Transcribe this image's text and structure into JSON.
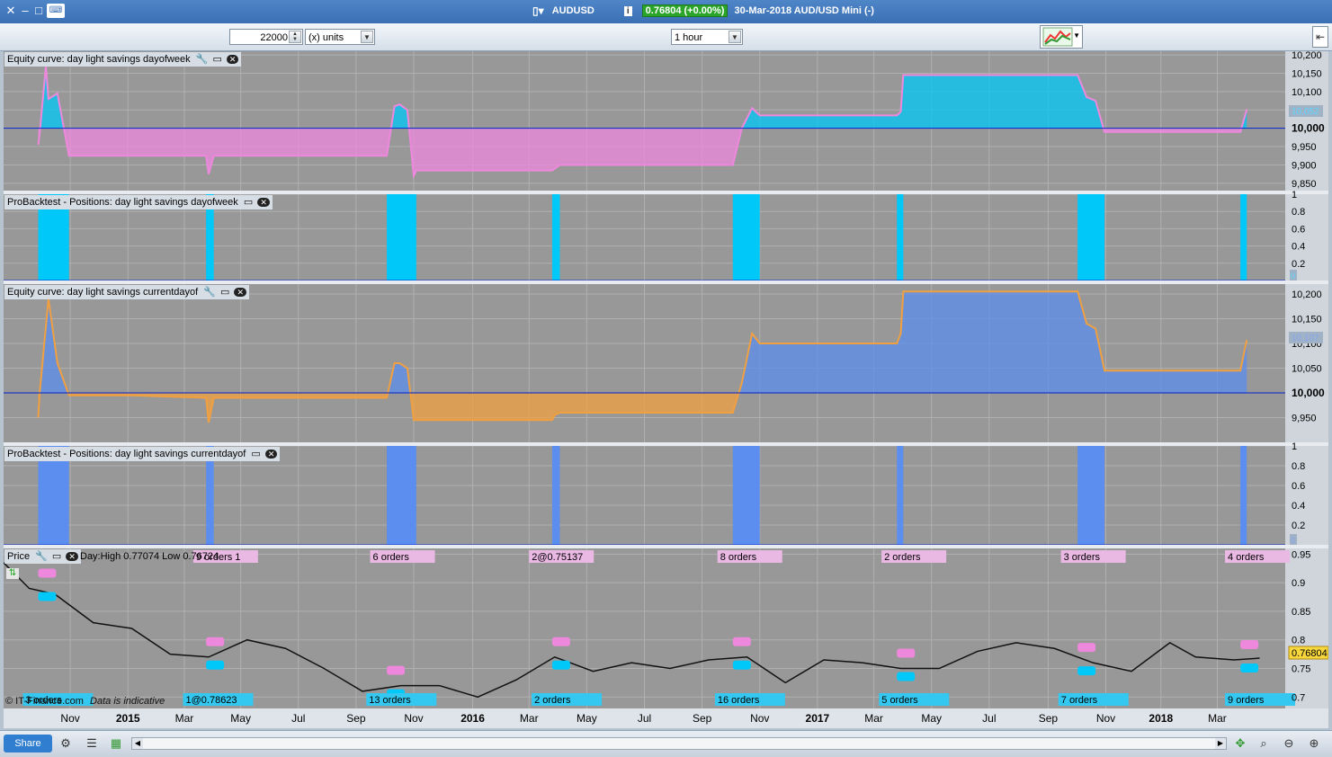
{
  "window": {
    "instrument": "AUDUSD",
    "price": "0.76804 (+0.00%)",
    "date_info": "30-Mar-2018 AUD/USD Mini (-)"
  },
  "toolbar": {
    "quantity": "22000",
    "units": "(x) units",
    "timeframe": "1 hour"
  },
  "colors": {
    "panel_bg": "#989898",
    "cyan": "#00c8f8",
    "pink": "#ee88dd",
    "blue_fill": "#5b8eee",
    "orange": "#f0a040",
    "baseline": "#0022cc"
  },
  "panels": {
    "equity1": {
      "title": "Equity curve: day light savings dayofweek",
      "ticks": [
        "10,200",
        "10,150",
        "10,100",
        "10,050",
        "10,000",
        "9,950",
        "9,900",
        "9,850"
      ],
      "current": "10,052"
    },
    "pos1": {
      "title": "ProBacktest - Positions: day light savings dayofweek",
      "ticks": [
        "1",
        "0.8",
        "0.6",
        "0.4",
        "0.2"
      ],
      "current": "0"
    },
    "equity2": {
      "title": "Equity curve: day light savings currentdayof",
      "ticks": [
        "10,200",
        "10,150",
        "10,100",
        "10,050",
        "10,000",
        "9,950"
      ],
      "current": "10,107"
    },
    "pos2": {
      "title": "ProBacktest - Positions: day light savings currentdayof",
      "ticks": [
        "1",
        "0.8",
        "0.6",
        "0.4",
        "0.2"
      ],
      "current": "0"
    },
    "price": {
      "title": "Price",
      "info": "Day:High 0.77074 Low 0.76724",
      "ticks": [
        "0.95",
        "0.9",
        "0.85",
        "0.8",
        "0.75",
        "0.7"
      ],
      "current": "0.76804",
      "watermark": "© IT-Finance.com",
      "indicative": "Data is indicative"
    }
  },
  "order_labels_top": [
    {
      "text": "9 orders 1",
      "t": 0.148
    },
    {
      "text": "6 orders",
      "t": 0.286
    },
    {
      "text": "2@0.75137",
      "t": 0.41
    },
    {
      "text": "8 orders",
      "t": 0.557
    },
    {
      "text": "2 orders",
      "t": 0.685
    },
    {
      "text": "3 orders",
      "t": 0.825
    },
    {
      "text": "4 orders",
      "t": 0.953
    }
  ],
  "order_labels_bottom": [
    {
      "text": "3 orders",
      "t": 0.015
    },
    {
      "text": "1@0.78623",
      "t": 0.14
    },
    {
      "text": "13 orders",
      "t": 0.283
    },
    {
      "text": "2 orders",
      "t": 0.412
    },
    {
      "text": "16 orders",
      "t": 0.555
    },
    {
      "text": "5 orders",
      "t": 0.683
    },
    {
      "text": "7 orders",
      "t": 0.823
    },
    {
      "text": "9 orders",
      "t": 0.953
    }
  ],
  "xaxis": {
    "labels": [
      {
        "text": "Nov",
        "t": 0.052,
        "bold": false
      },
      {
        "text": "2015",
        "t": 0.097,
        "bold": true
      },
      {
        "text": "Mar",
        "t": 0.141,
        "bold": false
      },
      {
        "text": "May",
        "t": 0.185,
        "bold": false
      },
      {
        "text": "Jul",
        "t": 0.23,
        "bold": false
      },
      {
        "text": "Sep",
        "t": 0.275,
        "bold": false
      },
      {
        "text": "Nov",
        "t": 0.32,
        "bold": false
      },
      {
        "text": "2016",
        "t": 0.366,
        "bold": true
      },
      {
        "text": "Mar",
        "t": 0.41,
        "bold": false
      },
      {
        "text": "May",
        "t": 0.455,
        "bold": false
      },
      {
        "text": "Jul",
        "t": 0.5,
        "bold": false
      },
      {
        "text": "Sep",
        "t": 0.545,
        "bold": false
      },
      {
        "text": "Nov",
        "t": 0.59,
        "bold": false
      },
      {
        "text": "2017",
        "t": 0.635,
        "bold": true
      },
      {
        "text": "Mar",
        "t": 0.679,
        "bold": false
      },
      {
        "text": "May",
        "t": 0.724,
        "bold": false
      },
      {
        "text": "Jul",
        "t": 0.769,
        "bold": false
      },
      {
        "text": "Sep",
        "t": 0.815,
        "bold": false
      },
      {
        "text": "Nov",
        "t": 0.86,
        "bold": false
      },
      {
        "text": "2018",
        "t": 0.903,
        "bold": true
      },
      {
        "text": "Mar",
        "t": 0.947,
        "bold": false
      }
    ]
  },
  "positions": [
    {
      "start": 0.027,
      "end": 0.051
    },
    {
      "start": 0.158,
      "end": 0.164
    },
    {
      "start": 0.299,
      "end": 0.322
    },
    {
      "start": 0.428,
      "end": 0.434
    },
    {
      "start": 0.569,
      "end": 0.59
    },
    {
      "start": 0.697,
      "end": 0.702
    },
    {
      "start": 0.838,
      "end": 0.859
    },
    {
      "start": 0.965,
      "end": 0.97
    }
  ],
  "equity1_series": {
    "t": [
      0.027,
      0.028,
      0.033,
      0.035,
      0.042,
      0.051,
      0.1,
      0.158,
      0.16,
      0.164,
      0.22,
      0.299,
      0.305,
      0.309,
      0.315,
      0.32,
      0.322,
      0.36,
      0.428,
      0.43,
      0.434,
      0.5,
      0.569,
      0.576,
      0.584,
      0.59,
      0.63,
      0.697,
      0.7,
      0.702,
      0.78,
      0.838,
      0.845,
      0.852,
      0.859,
      0.91,
      0.965,
      0.97
    ],
    "v": [
      9955,
      9980,
      10170,
      10080,
      10095,
      9925,
      9925,
      9925,
      9875,
      9925,
      9925,
      9925,
      10060,
      10065,
      10050,
      9870,
      9885,
      9885,
      9885,
      9890,
      9900,
      9900,
      9900,
      10000,
      10055,
      10035,
      10035,
      10035,
      10045,
      10145,
      10145,
      10145,
      10085,
      10075,
      9990,
      9990,
      9990,
      10052
    ]
  },
  "equity2_series": {
    "t": [
      0.027,
      0.028,
      0.035,
      0.042,
      0.051,
      0.1,
      0.158,
      0.16,
      0.164,
      0.22,
      0.299,
      0.305,
      0.309,
      0.315,
      0.32,
      0.322,
      0.36,
      0.428,
      0.43,
      0.434,
      0.5,
      0.569,
      0.576,
      0.584,
      0.59,
      0.63,
      0.697,
      0.7,
      0.702,
      0.78,
      0.838,
      0.845,
      0.852,
      0.859,
      0.91,
      0.965,
      0.97
    ],
    "v": [
      9950,
      9995,
      10190,
      10060,
      9995,
      9995,
      9990,
      9940,
      9990,
      9990,
      9990,
      10060,
      10060,
      10050,
      9945,
      9945,
      9945,
      9945,
      9955,
      9960,
      9960,
      9960,
      10020,
      10120,
      10100,
      10100,
      10100,
      10120,
      10205,
      10205,
      10205,
      10140,
      10130,
      10045,
      10045,
      10045,
      10107
    ]
  },
  "price_series": {
    "t": [
      0,
      0.02,
      0.04,
      0.07,
      0.1,
      0.13,
      0.16,
      0.19,
      0.22,
      0.25,
      0.28,
      0.31,
      0.34,
      0.37,
      0.4,
      0.43,
      0.46,
      0.49,
      0.52,
      0.55,
      0.58,
      0.61,
      0.64,
      0.67,
      0.7,
      0.73,
      0.76,
      0.79,
      0.82,
      0.85,
      0.88,
      0.91,
      0.93,
      0.96,
      0.98
    ],
    "v": [
      0.935,
      0.89,
      0.88,
      0.83,
      0.82,
      0.775,
      0.77,
      0.8,
      0.785,
      0.75,
      0.71,
      0.72,
      0.72,
      0.7,
      0.73,
      0.77,
      0.745,
      0.76,
      0.75,
      0.765,
      0.77,
      0.725,
      0.765,
      0.76,
      0.75,
      0.75,
      0.78,
      0.795,
      0.785,
      0.76,
      0.745,
      0.795,
      0.77,
      0.765,
      0.768
    ]
  },
  "bottombar": {
    "share": "Share"
  }
}
